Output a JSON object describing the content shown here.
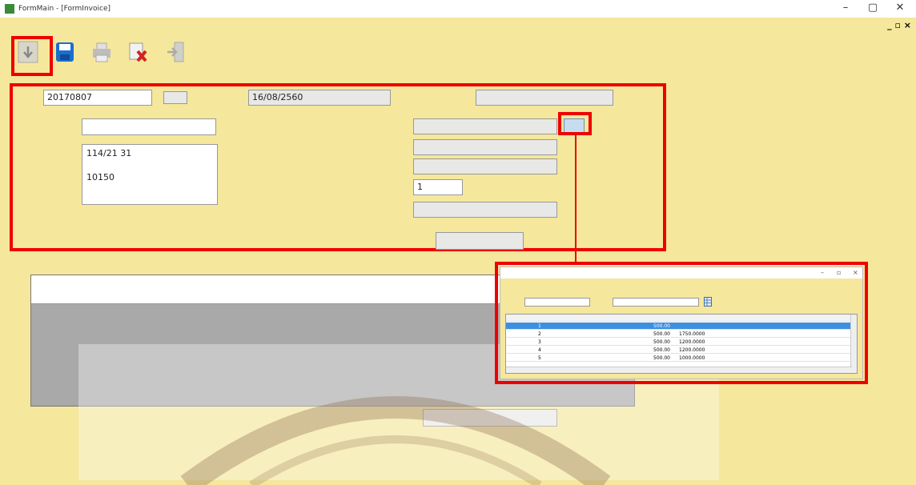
{
  "window": {
    "title": "FormMain - [FormInvoice]",
    "controls": [
      "–",
      "▢",
      "✕"
    ],
    "mdi_controls": "_ ▫ ×"
  },
  "menu": {
    "items": [
      "",
      "",
      "",
      "",
      "",
      ""
    ]
  },
  "toolbar": {
    "buttons": [
      {
        "label": "",
        "icon": "down-arrow-icon"
      },
      {
        "label": "",
        "icon": "save-icon"
      },
      {
        "label": "",
        "icon": "print-icon"
      },
      {
        "label": "",
        "icon": "cancel-icon"
      },
      {
        "label": "",
        "icon": "exit-icon"
      }
    ]
  },
  "invoice": {
    "number_label": "",
    "number": "20170807",
    "date_label": "",
    "date": "16/08/2560",
    "employee_label": "",
    "employee": ""
  },
  "customer": {
    "section_label": "",
    "name_label": "",
    "name": "",
    "address_label": "",
    "address": "114/21     31\n\n10150 "
  },
  "product": {
    "section_label": "",
    "code_label": "",
    "name_label": "",
    "stock_label": "",
    "qty_label": "",
    "qty": "1",
    "unit_label": "",
    "add_button": ""
  },
  "items_grid": {
    "columns": [
      "",
      "",
      "",
      "",
      ""
    ]
  },
  "total_label": "",
  "status": {
    "user": "",
    "role": "",
    "datetime": ""
  },
  "popup": {
    "title": "",
    "section_label": "",
    "combo_value": "",
    "columns": [
      "",
      "",
      "",
      "",
      "",
      "",
      "",
      ""
    ],
    "rows": [
      {
        "id": "1",
        "name": "",
        "stock": "",
        "cost": "500.00",
        "price": "",
        "type": "",
        "brand": ""
      },
      {
        "id": "2",
        "name": "",
        "stock": "",
        "cost": "500.00",
        "price": "1750.0000",
        "type": "",
        "brand": ""
      },
      {
        "id": "3",
        "name": "",
        "stock": "",
        "cost": "500.00",
        "price": "1200.0000",
        "type": "",
        "brand": ""
      },
      {
        "id": "4",
        "name": "",
        "stock": "",
        "cost": "500.00",
        "price": "1200.0000",
        "type": "",
        "brand": ""
      },
      {
        "id": "5",
        "name": "",
        "stock": "",
        "cost": "500.00",
        "price": "1000.0000",
        "type": "",
        "brand": ""
      }
    ]
  },
  "colors": {
    "background": "#f5e79c",
    "highlight": "#e00000",
    "selection": "#3d8fe0"
  }
}
